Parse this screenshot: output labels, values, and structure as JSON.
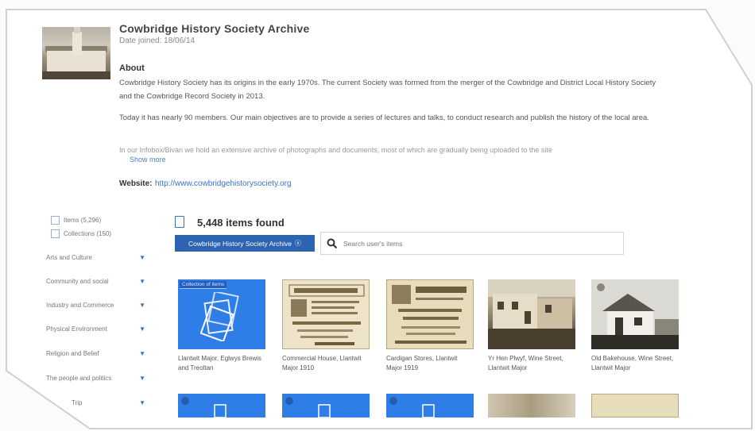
{
  "header": {
    "title": "Cowbridge History Society Archive",
    "date_joined": "Date joined: 18/06/14"
  },
  "about": {
    "heading": "About",
    "p1": "Cowbridge History Society has its origins in the early 1970s. The current Society was formed from the merger of the Cowbridge and District Local History Society and the Cowbridge Record Society in 2013.",
    "p2": "Today it has nearly 90 members. Our main objectives are to provide a series of lectures and talks, to conduct research and publish the history of the local area.",
    "p3": "In our Infobox/Bivan we hold an extensive archive of photographs and documents, most of which are gradually being uploaded to the site",
    "show_more": "Show more",
    "website_label": "Website:",
    "website_url": "http://www.cowbridgehistorysociety.org"
  },
  "sidebar": {
    "checkboxes": [
      {
        "label": "Items (5,296)"
      },
      {
        "label": "Collections (150)"
      }
    ],
    "categories": [
      {
        "label": "Arts and Culture"
      },
      {
        "label": "Community and social"
      },
      {
        "label": "Industry and Commerce"
      },
      {
        "label": "Physical Environment"
      },
      {
        "label": "Religion and Belief"
      },
      {
        "label": "The people and politics"
      },
      {
        "label": "Trip"
      }
    ],
    "arrow_glyph": "▼"
  },
  "results": {
    "count_text": "5,448 items found",
    "filter_pill": "Cowbridge History Society Archive",
    "filter_remove": "ⓧ",
    "search_placeholder": "Search user's items"
  },
  "grid": {
    "row1": [
      {
        "caption": "Llantwit Major, Eglwys Brewis and Treoltan",
        "badge": "Collection of items"
      },
      {
        "caption": "Commercial House, Llantwit Major 1910"
      },
      {
        "caption": "Cardigan Stores, Llantwit Major 1919"
      },
      {
        "caption": "Yr Hen Plwyf, Wine Street, Llantwit Major"
      },
      {
        "caption": "Old Bakehouse, Wine Street, Llantwit Major"
      }
    ]
  },
  "colors": {
    "accent": "#2c64b2",
    "collection_tile": "#2f7ee8"
  }
}
